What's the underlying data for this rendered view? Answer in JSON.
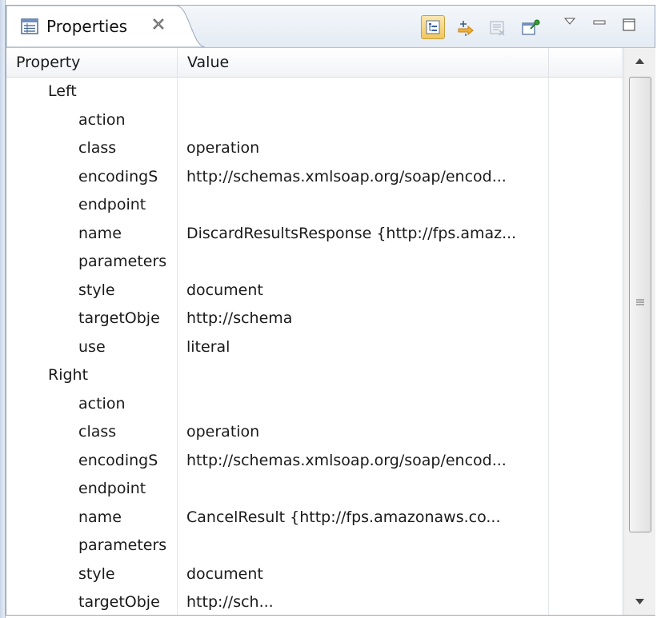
{
  "tab": {
    "title": "Properties",
    "icon": "properties-view-icon",
    "close": "close-icon"
  },
  "toolbar": {
    "buttons": [
      {
        "name": "show-categories-icon",
        "active": true
      },
      {
        "name": "show-advanced-properties-icon",
        "active": false
      },
      {
        "name": "restore-default-value-icon",
        "active": false
      },
      {
        "name": "pin-to-selection-icon",
        "active": false
      }
    ],
    "view_menu": "view-menu-icon",
    "minimize": "minimize-icon",
    "maximize": "maximize-icon"
  },
  "table": {
    "headers": {
      "property": "Property",
      "value": "Value"
    },
    "rows": [
      {
        "level": 0,
        "property": "Left",
        "value": ""
      },
      {
        "level": 1,
        "property": "action",
        "value": ""
      },
      {
        "level": 1,
        "property": "class",
        "value": "operation"
      },
      {
        "level": 1,
        "property": "encodingS",
        "value": "http://schemas.xmlsoap.org/soap/encod..."
      },
      {
        "level": 1,
        "property": "endpoint",
        "value": ""
      },
      {
        "level": 1,
        "property": "name",
        "value": "DiscardResultsResponse {http://fps.amaz..."
      },
      {
        "level": 1,
        "property": "parameters",
        "value": ""
      },
      {
        "level": 1,
        "property": "style",
        "value": "document"
      },
      {
        "level": 1,
        "property": "targetObje",
        "value": "http://schema"
      },
      {
        "level": 1,
        "property": "use",
        "value": "literal"
      },
      {
        "level": 0,
        "property": "Right",
        "value": ""
      },
      {
        "level": 1,
        "property": "action",
        "value": ""
      },
      {
        "level": 1,
        "property": "class",
        "value": "operation"
      },
      {
        "level": 1,
        "property": "encodingS",
        "value": "http://schemas.xmlsoap.org/soap/encod..."
      },
      {
        "level": 1,
        "property": "endpoint",
        "value": ""
      },
      {
        "level": 1,
        "property": "name",
        "value": "CancelResult {http://fps.amazonaws.co..."
      },
      {
        "level": 1,
        "property": "parameters",
        "value": ""
      },
      {
        "level": 1,
        "property": "style",
        "value": "document"
      },
      {
        "level": 1,
        "property": "targetObje",
        "value": "http://sch..."
      }
    ]
  },
  "scrollbar": {
    "up": "scroll-up-arrow-icon",
    "down": "scroll-down-arrow-icon",
    "grip": "scroll-grip-icon"
  }
}
